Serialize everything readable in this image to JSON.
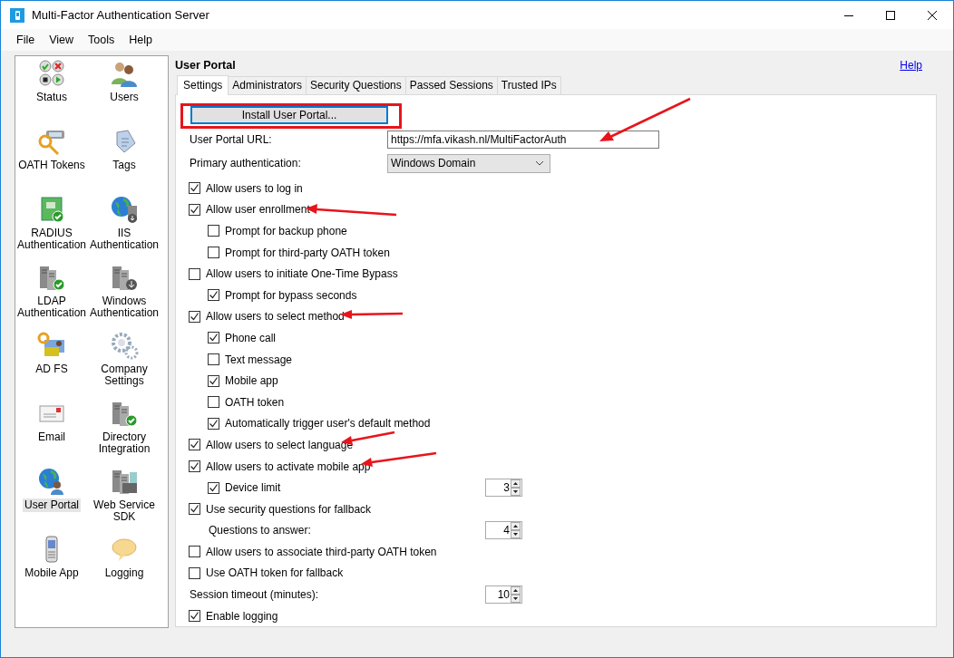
{
  "window": {
    "title": "Multi-Factor Authentication Server"
  },
  "menu": [
    "File",
    "View",
    "Tools",
    "Help"
  ],
  "sidebar": {
    "items": [
      {
        "label": "Status",
        "selected": false
      },
      {
        "label": "Users",
        "selected": false
      },
      {
        "label": "OATH Tokens",
        "selected": false
      },
      {
        "label": "Tags",
        "selected": false
      },
      {
        "label": "RADIUS Authentication",
        "selected": false
      },
      {
        "label": "IIS Authentication",
        "selected": false
      },
      {
        "label": "LDAP Authentication",
        "selected": false
      },
      {
        "label": "Windows Authentication",
        "selected": false
      },
      {
        "label": "AD FS",
        "selected": false
      },
      {
        "label": "Company Settings",
        "selected": false
      },
      {
        "label": "Email",
        "selected": false
      },
      {
        "label": "Directory Integration",
        "selected": false
      },
      {
        "label": "User Portal",
        "selected": true
      },
      {
        "label": "Web Service SDK",
        "selected": false
      },
      {
        "label": "Mobile App",
        "selected": false
      },
      {
        "label": "Logging",
        "selected": false
      }
    ]
  },
  "heading": "User Portal",
  "help_link": "Help",
  "tabs": [
    {
      "label": "Settings",
      "selected": true
    },
    {
      "label": "Administrators",
      "selected": false
    },
    {
      "label": "Security Questions",
      "selected": false
    },
    {
      "label": "Passed Sessions",
      "selected": false
    },
    {
      "label": "Trusted IPs",
      "selected": false
    }
  ],
  "install_button": "Install User Portal...",
  "url_field": {
    "label": "User Portal URL:",
    "value": "https://mfa.vikash.nl/MultiFactorAuth"
  },
  "primary_auth": {
    "label": "Primary authentication:",
    "value": "Windows Domain"
  },
  "options": [
    {
      "kind": "checkbox",
      "label": "Allow users to log in",
      "checked": true
    },
    {
      "kind": "checkbox",
      "label": "Allow user enrollment",
      "checked": true,
      "children": [
        {
          "kind": "checkbox",
          "label": "Prompt for backup phone",
          "checked": false
        },
        {
          "kind": "checkbox",
          "label": "Prompt for third-party OATH token",
          "checked": false
        }
      ]
    },
    {
      "kind": "checkbox",
      "label": "Allow users to initiate One-Time Bypass",
      "checked": false,
      "children": [
        {
          "kind": "checkbox",
          "label": "Prompt for bypass seconds",
          "checked": true
        }
      ]
    },
    {
      "kind": "checkbox",
      "label": "Allow users to select method",
      "checked": true,
      "children": [
        {
          "kind": "checkbox",
          "label": "Phone call",
          "checked": true
        },
        {
          "kind": "checkbox",
          "label": "Text message",
          "checked": false
        },
        {
          "kind": "checkbox",
          "label": "Mobile app",
          "checked": true
        },
        {
          "kind": "checkbox",
          "label": "OATH token",
          "checked": false
        },
        {
          "kind": "checkbox",
          "label": "Automatically trigger user's default method",
          "checked": true
        }
      ]
    },
    {
      "kind": "checkbox",
      "label": "Allow users to select language",
      "checked": true
    },
    {
      "kind": "checkbox",
      "label": "Allow users to activate mobile app",
      "checked": true,
      "children": [
        {
          "kind": "checkbox",
          "label": "Device limit",
          "checked": true,
          "value": "3"
        }
      ]
    },
    {
      "kind": "checkbox",
      "label": "Use security questions for fallback",
      "checked": true,
      "children": [
        {
          "kind": "number",
          "label": "Questions to answer:",
          "value": "4"
        }
      ]
    },
    {
      "kind": "checkbox",
      "label": "Allow users to associate third-party OATH token",
      "checked": false
    },
    {
      "kind": "checkbox",
      "label": "Use OATH token for fallback",
      "checked": false
    },
    {
      "kind": "number",
      "label": "Session timeout (minutes):",
      "value": "10"
    },
    {
      "kind": "checkbox",
      "label": "Enable logging",
      "checked": true
    }
  ]
}
